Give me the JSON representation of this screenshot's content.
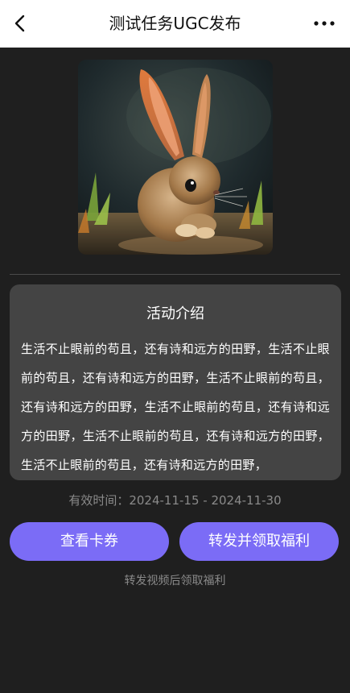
{
  "nav": {
    "back_icon": "back-chevron-icon",
    "title": "测试任务UGC发布",
    "more_icon": "more-dots-icon"
  },
  "hero": {
    "icon": "rabbit-photo"
  },
  "activity": {
    "title": "活动介绍",
    "body": "生活不止眼前的苟且，还有诗和远方的田野，生活不止眼前的苟且，还有诗和远方的田野，生活不止眼前的苟且，还有诗和远方的田野，生活不止眼前的苟且，还有诗和远方的田野，生活不止眼前的苟且，还有诗和远方的田野，生活不止眼前的苟且，还有诗和远方的田野，"
  },
  "validity": {
    "text": "有效时间：2024-11-15 - 2024-11-30"
  },
  "buttons": {
    "view_coupon": "查看卡券",
    "share_claim": "转发并领取福利"
  },
  "hint": {
    "text": "转发视频后领取福利"
  },
  "colors": {
    "accent": "#7b6cf6",
    "background": "#1f1f1f",
    "card": "#444444",
    "nav_background": "#ffffff"
  }
}
